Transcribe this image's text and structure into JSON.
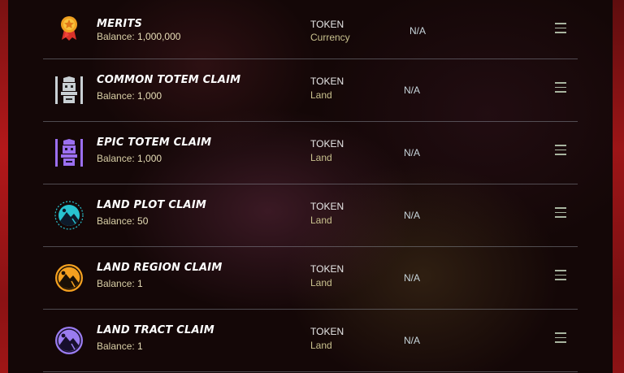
{
  "rows": [
    {
      "name": "MERITS",
      "balance_prefix": "Balance:",
      "balance": "1,000,000",
      "type": "TOKEN",
      "sub": "Currency",
      "price": "N/A",
      "icon": "merits-medal-icon"
    },
    {
      "name": "COMMON TOTEM CLAIM",
      "balance_prefix": "Balance:",
      "balance": "1,000",
      "type": "TOKEN",
      "sub": "Land",
      "price": "N/A",
      "icon": "common-totem-icon"
    },
    {
      "name": "EPIC TOTEM CLAIM",
      "balance_prefix": "Balance:",
      "balance": "1,000",
      "type": "TOKEN",
      "sub": "Land",
      "price": "N/A",
      "icon": "epic-totem-icon"
    },
    {
      "name": "LAND PLOT CLAIM",
      "balance_prefix": "Balance:",
      "balance": "50",
      "type": "TOKEN",
      "sub": "Land",
      "price": "N/A",
      "icon": "land-plot-icon"
    },
    {
      "name": "LAND REGION CLAIM",
      "balance_prefix": "Balance:",
      "balance": "1",
      "type": "TOKEN",
      "sub": "Land",
      "price": "N/A",
      "icon": "land-region-icon"
    },
    {
      "name": "LAND TRACT CLAIM",
      "balance_prefix": "Balance:",
      "balance": "1",
      "type": "TOKEN",
      "sub": "Land",
      "price": "N/A",
      "icon": "land-tract-icon"
    }
  ],
  "colors": {
    "totem_common": "#c9d0d4",
    "totem_epic": "#9b6ff0",
    "plot": "#28c2cf",
    "region": "#f4a020",
    "tract": "#9a7cf0"
  }
}
